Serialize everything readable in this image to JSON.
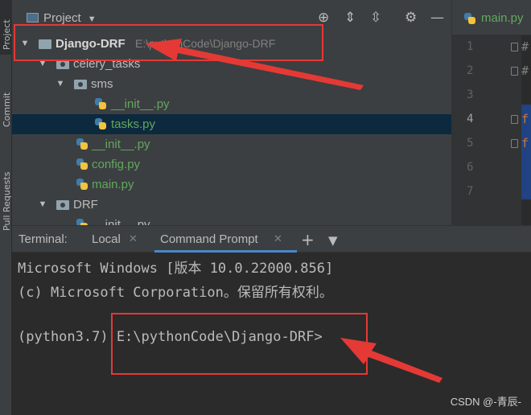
{
  "left_strip": {
    "tabs": [
      {
        "label": "Project"
      },
      {
        "label": "Commit"
      },
      {
        "label": "Pull Requests"
      }
    ]
  },
  "project_panel": {
    "title": "Project",
    "tree": [
      {
        "label": "Django-DRF",
        "path": "E:\\pythonCode\\Django-DRF"
      },
      {
        "label": "celery_tasks"
      },
      {
        "label": "sms"
      },
      {
        "label": "__init__.py"
      },
      {
        "label": "tasks.py"
      },
      {
        "label": "__init__.py"
      },
      {
        "label": "config.py"
      },
      {
        "label": "main.py"
      },
      {
        "label": "DRF"
      },
      {
        "label": "__init__.py"
      }
    ]
  },
  "editor": {
    "tab_label": "main.py",
    "line_numbers": [
      "1",
      "2",
      "3",
      "4",
      "5",
      "6",
      "7"
    ],
    "code": [
      "#",
      "#",
      "",
      "f",
      "f",
      "",
      ""
    ]
  },
  "terminal": {
    "title": "Terminal:",
    "tabs": [
      {
        "label": "Local"
      },
      {
        "label": "Command Prompt"
      }
    ],
    "lines": [
      "Microsoft Windows [版本 10.0.22000.856]",
      "(c) Microsoft Corporation。保留所有权利。",
      "",
      "(python3.7) E:\\pythonCode\\Django-DRF>"
    ]
  },
  "watermark": "CSDN @-青辰-",
  "annotation_color": "#e53935"
}
